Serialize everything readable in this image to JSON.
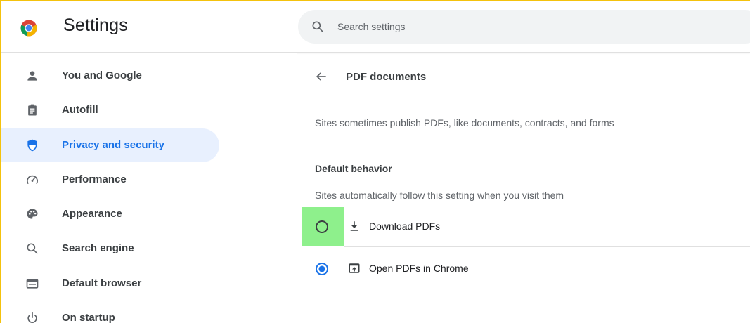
{
  "header": {
    "app_title": "Settings",
    "logo_icon": "chrome-logo-icon",
    "search": {
      "icon": "search-icon",
      "placeholder": "Search settings",
      "value": ""
    }
  },
  "sidebar": {
    "items": [
      {
        "label": "You and Google",
        "icon": "person-icon",
        "active": false
      },
      {
        "label": "Autofill",
        "icon": "clipboard-icon",
        "active": false
      },
      {
        "label": "Privacy and security",
        "icon": "shield-icon",
        "active": true
      },
      {
        "label": "Performance",
        "icon": "speedometer-icon",
        "active": false
      },
      {
        "label": "Appearance",
        "icon": "palette-icon",
        "active": false
      },
      {
        "label": "Search engine",
        "icon": "search-icon",
        "active": false
      },
      {
        "label": "Default browser",
        "icon": "browser-window-icon",
        "active": false
      },
      {
        "label": "On startup",
        "icon": "power-icon",
        "active": false
      }
    ]
  },
  "main": {
    "back_icon": "arrow-back-icon",
    "title": "PDF documents",
    "description": "Sites sometimes publish PDFs, like documents, contracts, and forms",
    "section": {
      "heading": "Default behavior",
      "subheading": "Sites automatically follow this setting when you visit them",
      "options": [
        {
          "label": "Download PDFs",
          "icon": "download-icon",
          "selected": false
        },
        {
          "label": "Open PDFs in Chrome",
          "icon": "open-in-browser-icon",
          "selected": true
        }
      ]
    }
  },
  "colors": {
    "accent": "#1a73e8",
    "active_bg": "#e8f0fe",
    "highlight": "#8ef08c",
    "window_border": "#f4c20d"
  }
}
